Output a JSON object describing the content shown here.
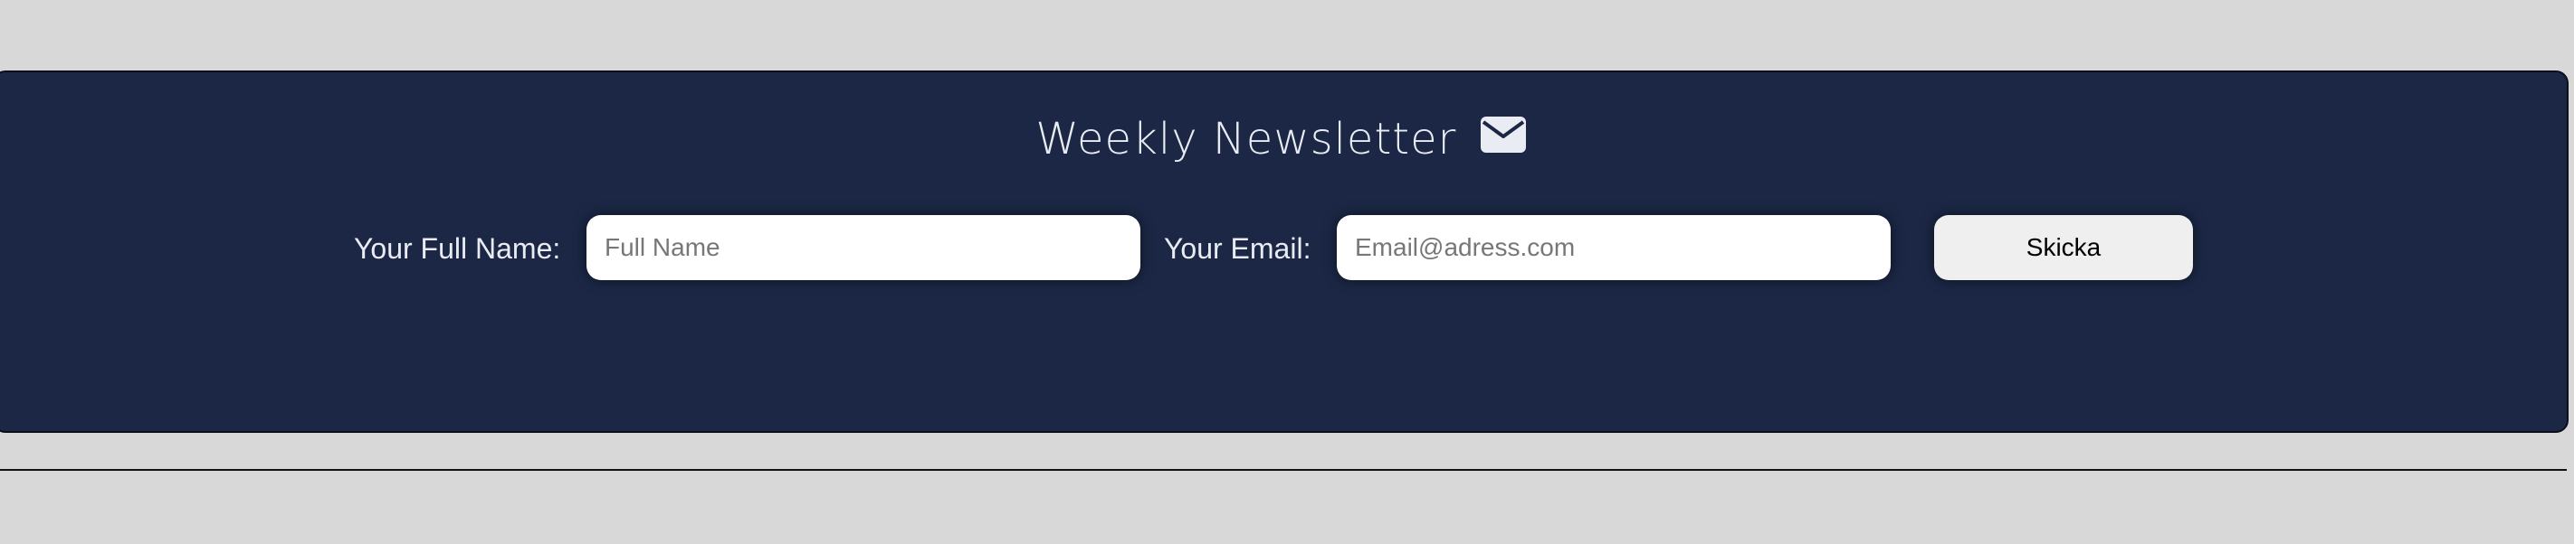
{
  "newsletter": {
    "title": "Weekly Newsletter",
    "title_icon": "envelope-icon",
    "name_label": "Your Full Name:",
    "name_placeholder": "Full Name",
    "email_label": "Your Email:",
    "email_placeholder": "Email@adress.com",
    "submit_label": "Skicka"
  },
  "colors": {
    "page_background": "#d8d8d8",
    "panel_background": "#1b2745",
    "text_light": "#e9ecf3",
    "button_background": "#efefef"
  }
}
